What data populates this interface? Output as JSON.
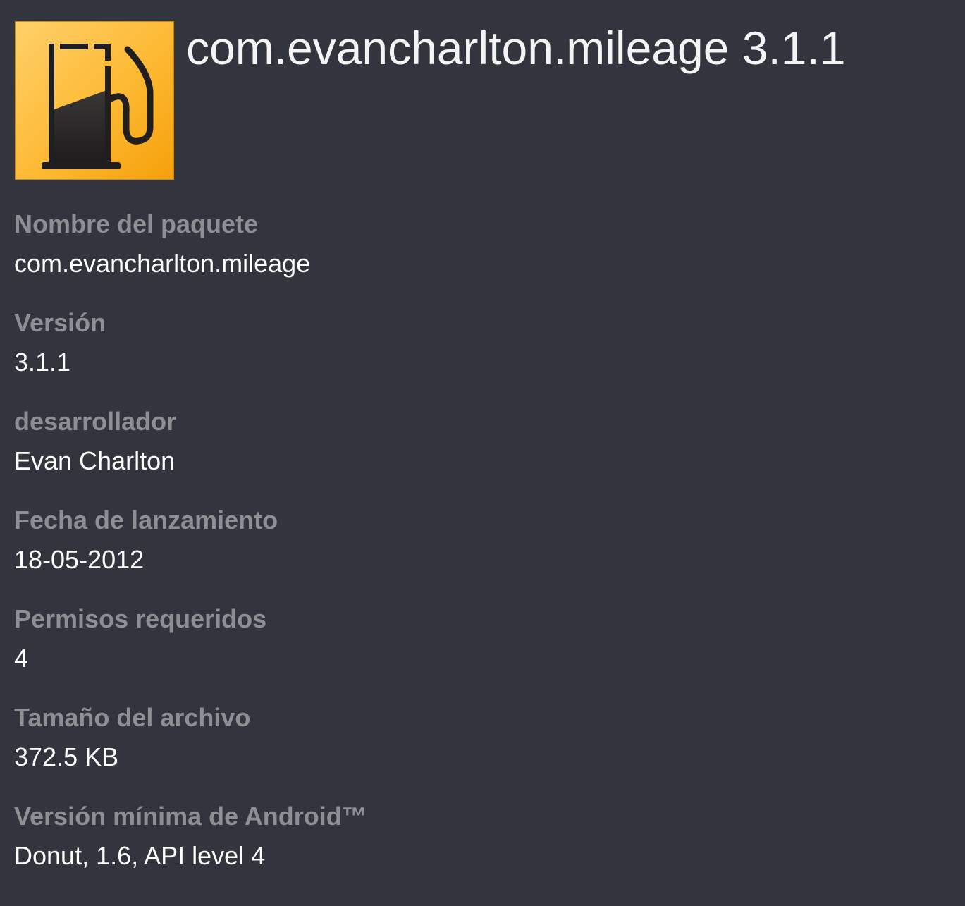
{
  "header": {
    "title": "com.evancharlton.mileage 3.1.1",
    "icon": "fuel-pump-icon",
    "icon_colors": {
      "background_light": "#ffc54d",
      "background_dark": "#f6a40d",
      "pump": "#201e1e"
    }
  },
  "details": [
    {
      "label": "Nombre del paquete",
      "value": "com.evancharlton.mileage"
    },
    {
      "label": "Versión",
      "value": "3.1.1"
    },
    {
      "label": "desarrollador",
      "value": "Evan Charlton"
    },
    {
      "label": "Fecha de lanzamiento",
      "value": "18-05-2012"
    },
    {
      "label": "Permisos requeridos",
      "value": "4"
    },
    {
      "label": "Tamaño del archivo",
      "value": "372.5 KB"
    },
    {
      "label": "Versión mínima de Android™",
      "value": "Donut, 1.6, API level 4"
    }
  ],
  "colors": {
    "background": "#32353d",
    "label": "#8e8f93",
    "value": "#ffffff"
  }
}
